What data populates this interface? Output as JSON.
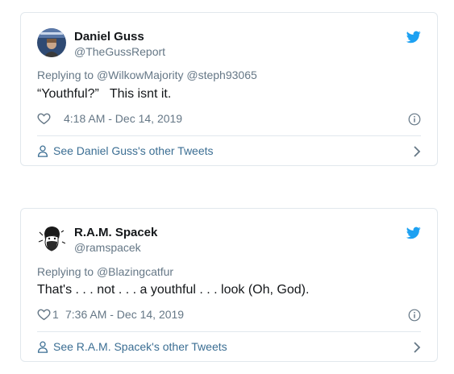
{
  "colors": {
    "twitter_blue": "#1da1f2",
    "muted": "#657786",
    "link": "#3b6e93",
    "border": "#e1e8ed"
  },
  "tweets": [
    {
      "name": "Daniel Guss",
      "handle": "@TheGussReport",
      "replying_prefix": "Replying to",
      "replying_to": "@WilkowMajority @steph93065",
      "text": "“Youthful?”   This isnt it.",
      "likes": "",
      "timestamp": "4:18 AM - Dec 14, 2019",
      "footer": "See Daniel Guss's other Tweets",
      "avatar_icon": "avatar-photo",
      "brand_icon": "twitter-bird-icon"
    },
    {
      "name": "R.A.M. Spacek",
      "handle": "@ramspacek",
      "replying_prefix": "Replying to",
      "replying_to": "@Blazingcatfur",
      "text": "That's . . . not . . . a youthful . . . look (Oh, God).",
      "likes": "1",
      "timestamp": "7:36 AM - Dec 14, 2019",
      "footer": "See R.A.M. Spacek's other Tweets",
      "avatar_icon": "avatar-drawing",
      "brand_icon": "twitter-bird-icon"
    }
  ]
}
